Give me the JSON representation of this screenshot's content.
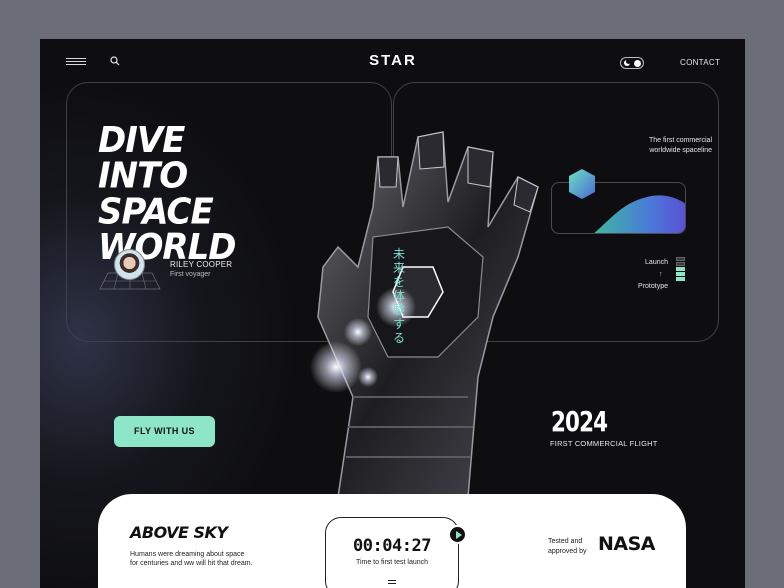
{
  "nav": {
    "logo": "STAR",
    "contact": "CONTACT"
  },
  "hero": {
    "headline": [
      "DIVE INTO",
      "SPACE",
      "WORLD"
    ],
    "person_name": "RILEY COOPER",
    "person_role": "First voyager",
    "cta_label": "FLY WITH US",
    "vertical_text": "未来を体験する"
  },
  "info": {
    "spaceline_line1": "The first commercial",
    "spaceline_line2": "worldwide spaceline",
    "launch_label": "Launch",
    "arrow": "↑",
    "prototype_label": "Prototype",
    "levels": [
      false,
      false,
      true,
      true,
      true
    ]
  },
  "milestone": {
    "year": "2024",
    "caption": "FIRST COMMERCIAL FLIGHT"
  },
  "bottom": {
    "title": "ABOVE SKY",
    "text_line1": "Humans were dreaming about space",
    "text_line2": "for centuries and ww will hit that dream.",
    "timer": "00:04:27",
    "timer_caption": "Time to first test launch",
    "tested_line1": "Tested and",
    "tested_line2": "approved by",
    "partner_logo": "NASA"
  },
  "colors": {
    "accent": "#8ee6c8",
    "background": "#0e0e11",
    "frame_outer": "#6b6e78"
  }
}
